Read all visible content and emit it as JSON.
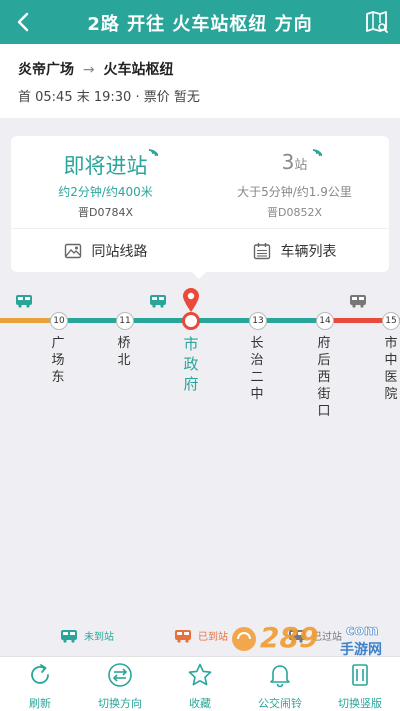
{
  "header": {
    "title": "2路 开往 火车站枢纽 方向"
  },
  "route": {
    "from": "炎帝广场",
    "arrow": "→",
    "to": "火车站枢纽",
    "schedule": "首 05:45 末 19:30 · 票价 暂无"
  },
  "buses": [
    {
      "status": "即将进站",
      "detail": "约2分钟/约400米",
      "plate": "晋D0784X"
    },
    {
      "stops_value": "3",
      "stops_unit": "站",
      "detail": "大于5分钟/约1.9公里",
      "plate": "晋D0852X"
    }
  ],
  "card_actions": {
    "same_stop": "同站线路",
    "vehicle_list": "车辆列表"
  },
  "stops": [
    {
      "number": "10",
      "name": "广场东"
    },
    {
      "number": "11",
      "name": "桥北"
    },
    {
      "number": "",
      "name": "市政府",
      "current": true
    },
    {
      "number": "13",
      "name": "长治二中"
    },
    {
      "number": "14",
      "name": "府后西街口"
    },
    {
      "number": "15",
      "name": "市中医院"
    }
  ],
  "legend": {
    "not_arrived": "未到站",
    "arrived": "已到站",
    "passed": "已过站"
  },
  "toolbar": {
    "refresh": "刷新",
    "switch_direction": "切换方向",
    "favorite": "收藏",
    "alarm": "公交闹铃",
    "switch_layout": "切换竖版"
  },
  "colors": {
    "primary": "#2aa59a",
    "passed": "#e8a23b",
    "upcoming": "#e84a3b",
    "gray": "#888888"
  },
  "watermark": {
    "brand": "289",
    "suffix": "com",
    "tagline": "手游网"
  }
}
